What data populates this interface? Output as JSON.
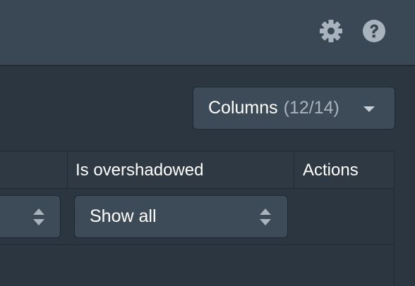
{
  "toolbar": {
    "settings_icon": "gear-icon",
    "help_icon": "help-icon"
  },
  "columns_button": {
    "label": "Columns",
    "count": "(12/14)"
  },
  "table": {
    "headers": [
      "Is overshadowed",
      "Actions"
    ],
    "filters": {
      "left_select_value": "",
      "is_overshadowed_select_value": "Show all"
    }
  },
  "colors": {
    "topbar": "#3a4755",
    "background": "#2b3640",
    "control": "#3d4b58",
    "text": "#ffffff",
    "muted_text": "#a8b3bd"
  }
}
